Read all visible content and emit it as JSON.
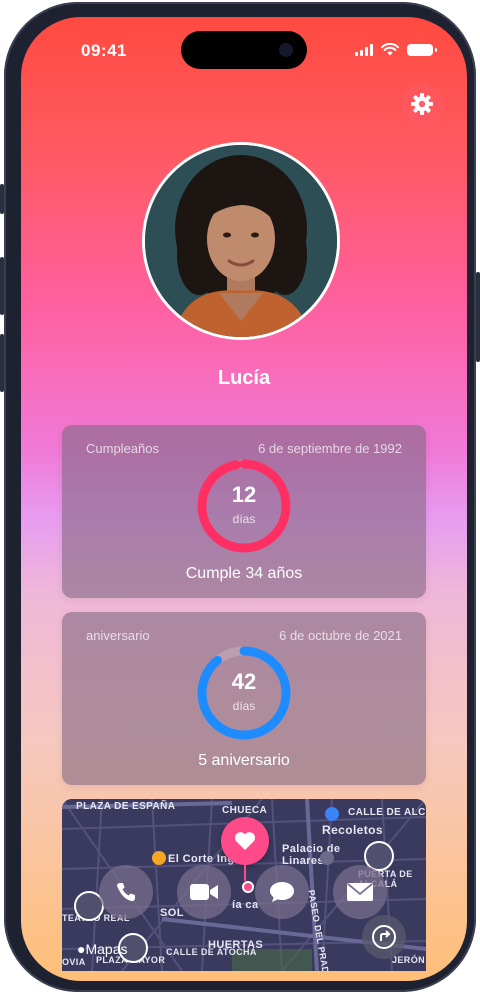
{
  "status_bar": {
    "time": "09:41"
  },
  "profile": {
    "name": "Lucía"
  },
  "cards": [
    {
      "label": "Cumpleaños",
      "date": "6 de septiembre de 1992",
      "count": "12",
      "unit": "días",
      "caption": "Cumple 34 años",
      "ring_color": "#ff2f63",
      "ring_fraction": 0.97
    },
    {
      "label": "aniversario",
      "date": "6 de octubre de 2021",
      "count": "42",
      "unit": "días",
      "caption": "5 aniversario",
      "ring_color": "#1e8cff",
      "ring_fraction": 0.89
    }
  ],
  "map": {
    "labels": [
      "PLAZA DE ESPAÑA",
      "CHUECA",
      "CALLE DE ALC",
      "Recoletos",
      "El Corte Ingl",
      "Palacio de Linares",
      "TEATRO REAL",
      "SOL",
      "ía ca",
      "HUERTAS",
      "PLAZA MAYOR",
      "CALLE DE ATOCHA",
      "PASEO DEL PRADO",
      "PUERTA DE ALCALÁ",
      "JERÓN",
      "OVIA"
    ],
    "attribution": "Mapas"
  },
  "actions": [
    "phone-icon",
    "video-icon",
    "message-icon",
    "mail-icon"
  ],
  "colors": {
    "birthday_ring": "#ff2f63",
    "anniversary_ring": "#1e8cff",
    "heart_pin": "#ff4a8a"
  }
}
